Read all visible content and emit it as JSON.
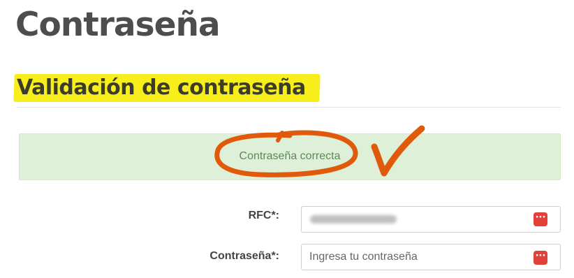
{
  "page": {
    "title": "Contraseña",
    "section_title": "Validación de contraseña"
  },
  "alert": {
    "message": "Contraseña correcta",
    "background": "#dff0d8",
    "text_color": "#5b8a56"
  },
  "annotation": {
    "color": "#e05a0c",
    "shapes": [
      "circle-around-message",
      "checkmark"
    ]
  },
  "form": {
    "rfc": {
      "label": "RFC*:",
      "value_obscured": true,
      "icon": "password-manager-icon"
    },
    "password": {
      "label": "Contraseña*:",
      "placeholder": "Ingresa tu contraseña",
      "icon": "password-manager-icon"
    }
  },
  "colors": {
    "highlight": "#f7ee1b",
    "title": "#4d4d4d",
    "icon_red": "#e0413b"
  }
}
